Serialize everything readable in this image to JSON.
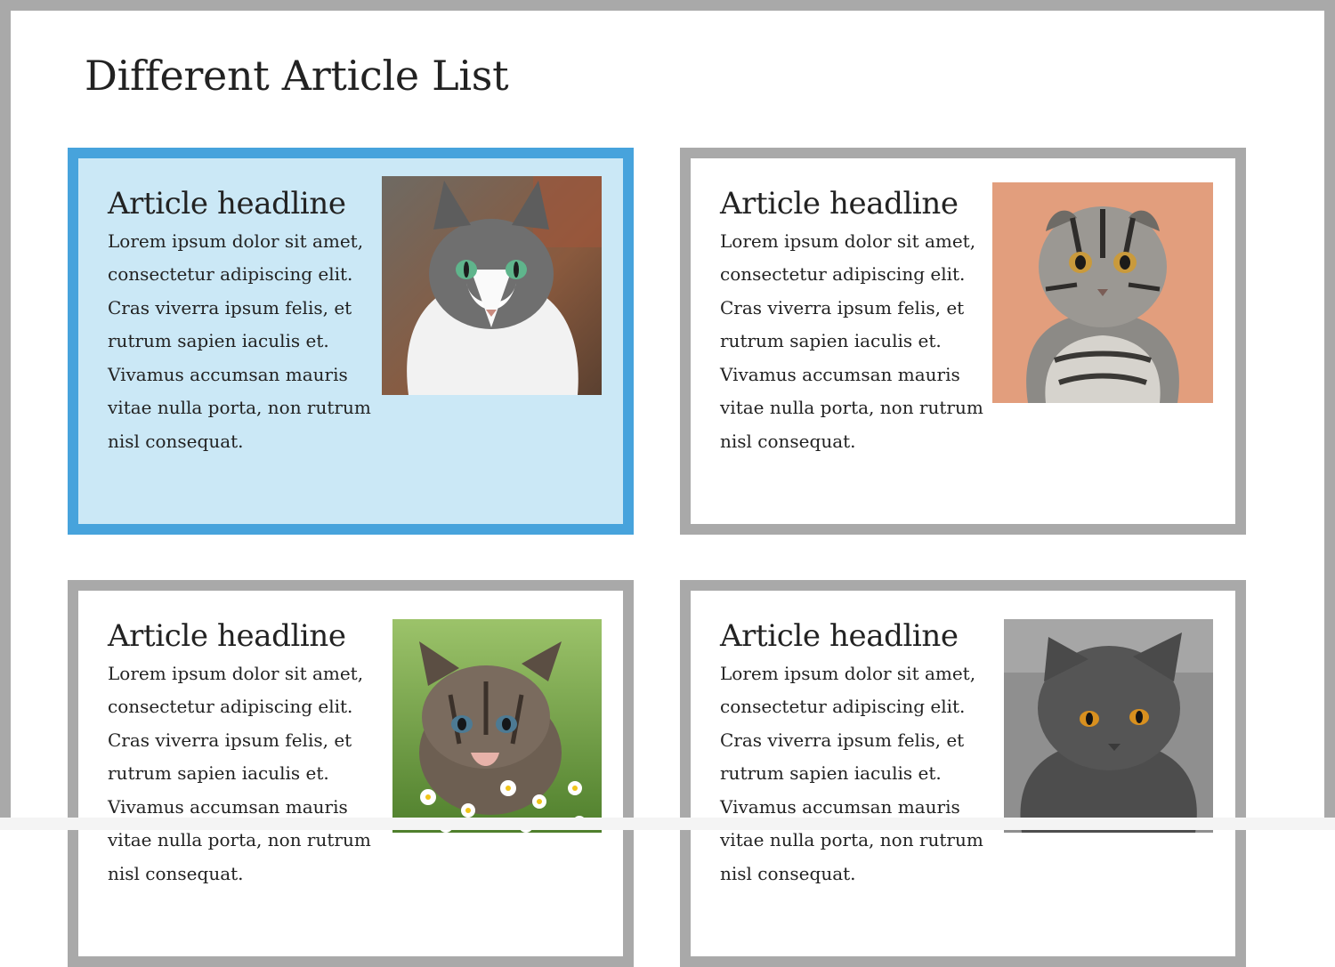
{
  "page": {
    "title": "Different Article List"
  },
  "articles": [
    {
      "headline": "Article headline",
      "body": "Lorem ipsum dolor sit amet, consectetur adipiscing elit. Cras viverra ipsum felis, et rutrum sapien iaculis et. Vivamus accumsan mauris vitae nulla porta, non rutrum nisl consequat.",
      "image": "cat-photo-tabby-white",
      "selected": true
    },
    {
      "headline": "Article headline",
      "body": "Lorem ipsum dolor sit amet, consectetur adipiscing elit. Cras viverra ipsum felis, et rutrum sapien iaculis et. Vivamus accumsan mauris vitae nulla porta, non rutrum nisl consequat.",
      "image": "cat-photo-scottish-fold",
      "selected": false
    },
    {
      "headline": "Article headline",
      "body": "Lorem ipsum dolor sit amet, consectetur adipiscing elit. Cras viverra ipsum felis, et rutrum sapien iaculis et. Vivamus accumsan mauris vitae nulla porta, non rutrum nisl consequat.",
      "image": "kitten-photo-flowers",
      "selected": false
    },
    {
      "headline": "Article headline",
      "body": "Lorem ipsum dolor sit amet, consectetur adipiscing elit. Cras viverra ipsum felis, et rutrum sapien iaculis et. Vivamus accumsan mauris vitae nulla porta, non rutrum nisl consequat.",
      "image": "cat-photo-grey-british",
      "selected": false
    }
  ],
  "colors": {
    "frame_border": "#a9a9a9",
    "active_border": "#47a3dc",
    "active_background": "#cbe8f6",
    "text": "#222222"
  }
}
